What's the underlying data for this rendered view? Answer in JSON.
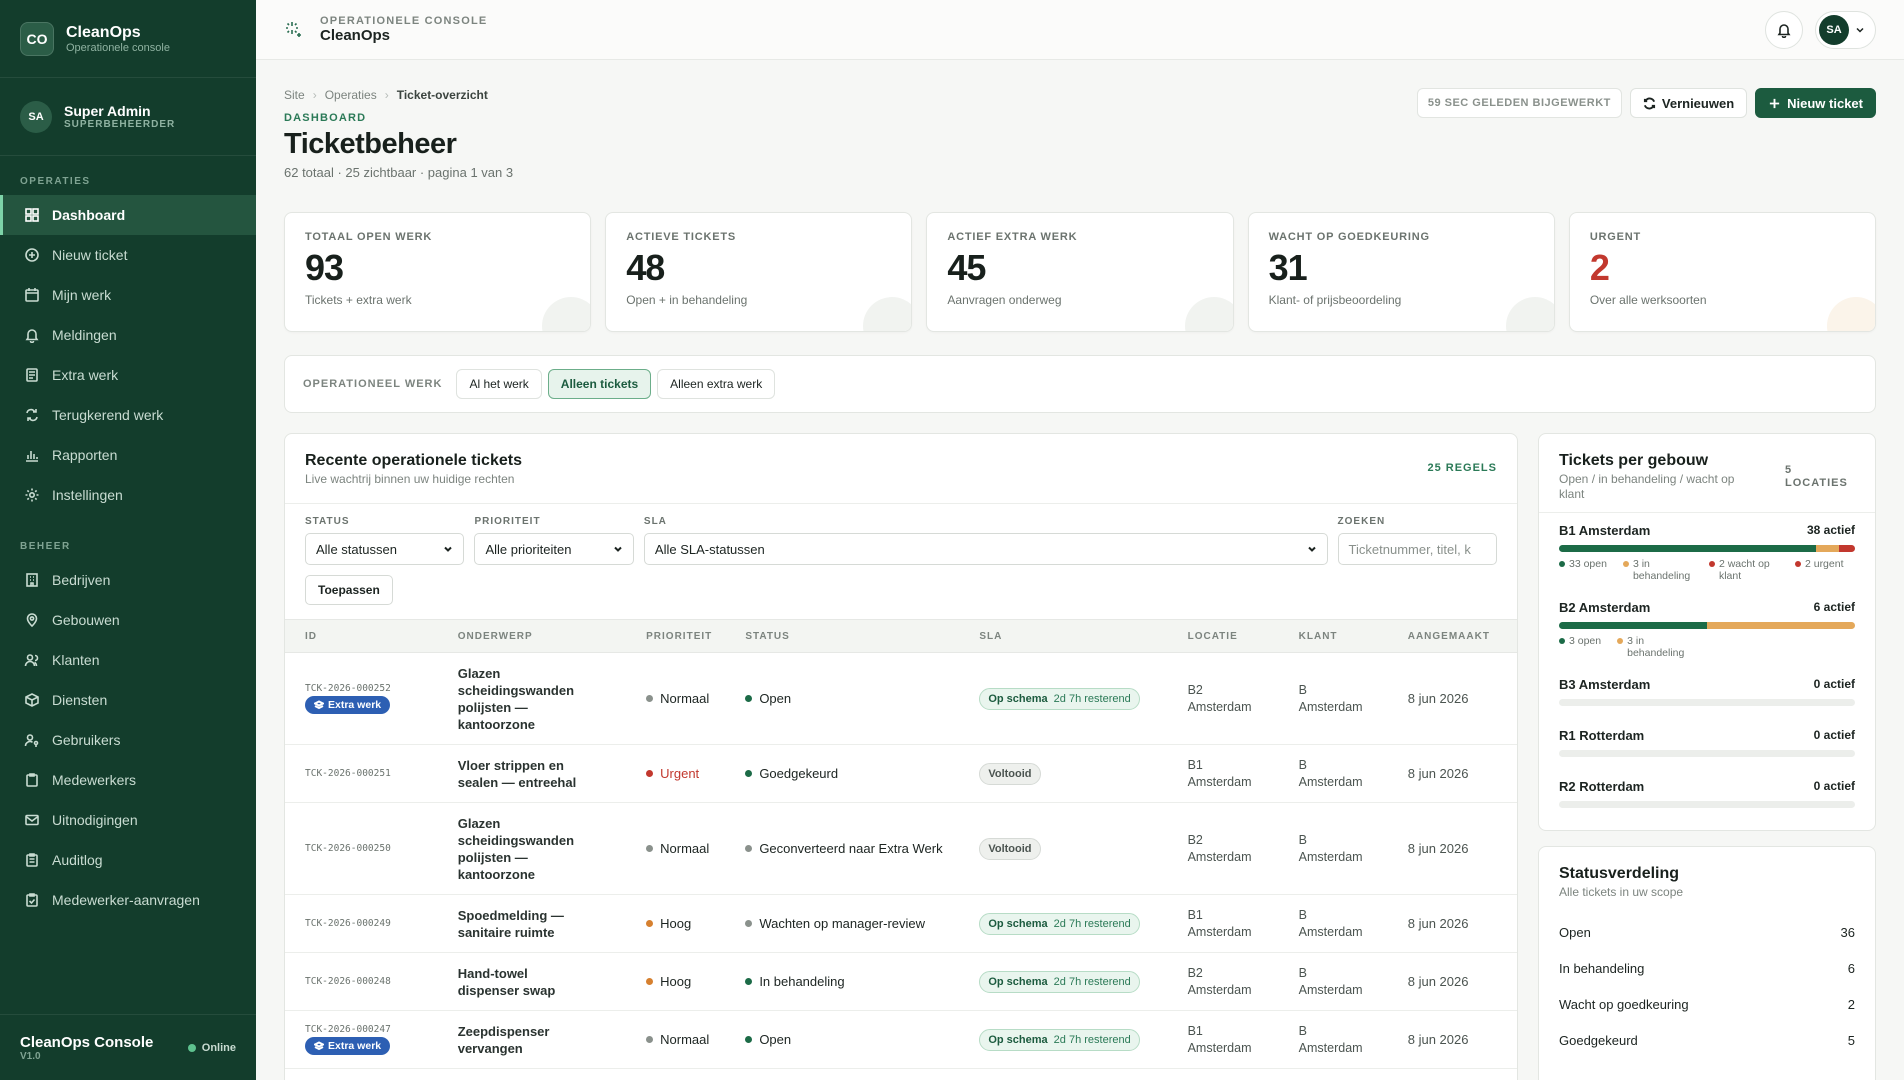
{
  "brand": {
    "logo": "CO",
    "title": "CleanOps",
    "subtitle": "Operationele console"
  },
  "user": {
    "initials": "SA",
    "name": "Super Admin",
    "role": "SUPERBEHEERDER"
  },
  "nav": {
    "section_ops": "OPERATIES",
    "ops": [
      {
        "label": "Dashboard",
        "icon": "grid-icon",
        "active": true
      },
      {
        "label": "Nieuw ticket",
        "icon": "plus-circle-icon"
      },
      {
        "label": "Mijn werk",
        "icon": "calendar-icon"
      },
      {
        "label": "Meldingen",
        "icon": "bell-icon"
      },
      {
        "label": "Extra werk",
        "icon": "document-icon"
      },
      {
        "label": "Terugkerend werk",
        "icon": "repeat-icon"
      },
      {
        "label": "Rapporten",
        "icon": "bar-chart-icon"
      },
      {
        "label": "Instellingen",
        "icon": "gear-icon"
      }
    ],
    "section_beheer": "BEHEER",
    "beheer": [
      {
        "label": "Bedrijven",
        "icon": "building-icon"
      },
      {
        "label": "Gebouwen",
        "icon": "map-pin-icon"
      },
      {
        "label": "Klanten",
        "icon": "users-icon"
      },
      {
        "label": "Diensten",
        "icon": "box-icon"
      },
      {
        "label": "Gebruikers",
        "icon": "user-key-icon"
      },
      {
        "label": "Medewerkers",
        "icon": "clipboard-icon"
      },
      {
        "label": "Uitnodigingen",
        "icon": "mail-icon"
      },
      {
        "label": "Auditlog",
        "icon": "clipboard-list-icon"
      },
      {
        "label": "Medewerker-aanvragen",
        "icon": "clipboard-check-icon"
      }
    ]
  },
  "footer": {
    "title": "CleanOps Console",
    "version": "V1.0",
    "status": "Online"
  },
  "topbar": {
    "kicker": "OPERATIONELE CONSOLE",
    "title": "CleanOps",
    "avatar": "SA"
  },
  "header": {
    "breadcrumb": [
      "Site",
      "Operaties",
      "Ticket-overzicht"
    ],
    "kicker": "DASHBOARD",
    "title": "Ticketbeheer",
    "subtitle": "62 totaal · 25 zichtbaar · pagina 1 van 3",
    "updated": "59 SEC GELEDEN BIJGEWERKT",
    "refresh": "Vernieuwen",
    "new_ticket": "Nieuw ticket"
  },
  "stats": [
    {
      "label": "TOTAAL OPEN WERK",
      "value": "93",
      "desc": "Tickets + extra werk"
    },
    {
      "label": "ACTIEVE TICKETS",
      "value": "48",
      "desc": "Open + in behandeling"
    },
    {
      "label": "ACTIEF EXTRA WERK",
      "value": "45",
      "desc": "Aanvragen onderweg"
    },
    {
      "label": "WACHT OP GOEDKEURING",
      "value": "31",
      "desc": "Klant- of prijsbeoordeling"
    },
    {
      "label": "URGENT",
      "value": "2",
      "desc": "Over alle werksoorten"
    }
  ],
  "work_filter": {
    "label": "OPERATIONEEL WERK",
    "options": [
      "Al het werk",
      "Alleen tickets",
      "Alleen extra werk"
    ],
    "active": "Alleen tickets"
  },
  "table": {
    "title": "Recente operationele tickets",
    "subtitle": "Live wachtrij binnen uw huidige rechten",
    "count": "25 REGELS",
    "filters": {
      "status_label": "STATUS",
      "status_value": "Alle statussen",
      "priority_label": "PRIORITEIT",
      "priority_value": "Alle prioriteiten",
      "sla_label": "SLA",
      "sla_value": "Alle SLA-statussen",
      "search_label": "ZOEKEN",
      "search_placeholder": "Ticketnummer, titel, k",
      "apply": "Toepassen"
    },
    "columns": [
      "ID",
      "ONDERWERP",
      "PRIORITEIT",
      "STATUS",
      "SLA",
      "LOCATIE",
      "KLANT",
      "AANGEMAAKT"
    ],
    "rows": [
      {
        "id": "TCK-2026-000252",
        "extra": "Extra werk",
        "subject": "Glazen scheidingswanden polijsten — kantoorzone",
        "priority": "Normaal",
        "status": "Open",
        "sla": "Op schema",
        "sla_rest": "2d 7h resterend",
        "location": "B2 Amsterdam",
        "client": "B Amsterdam",
        "created": "8 jun 2026"
      },
      {
        "id": "TCK-2026-000251",
        "extra": "",
        "subject": "Vloer strippen en sealen — entreehal",
        "priority": "Urgent",
        "status": "Goedgekeurd",
        "sla": "Voltooid",
        "sla_rest": "",
        "location": "B1 Amsterdam",
        "client": "B Amsterdam",
        "created": "8 jun 2026"
      },
      {
        "id": "TCK-2026-000250",
        "extra": "",
        "subject": "Glazen scheidingswanden polijsten — kantoorzone",
        "priority": "Normaal",
        "status": "Geconverteerd naar Extra Werk",
        "sla": "Voltooid",
        "sla_rest": "",
        "location": "B2 Amsterdam",
        "client": "B Amsterdam",
        "created": "8 jun 2026"
      },
      {
        "id": "TCK-2026-000249",
        "extra": "",
        "subject": "Spoedmelding — sanitaire ruimte",
        "priority": "Hoog",
        "status": "Wachten op manager-review",
        "sla": "Op schema",
        "sla_rest": "2d 7h resterend",
        "location": "B1 Amsterdam",
        "client": "B Amsterdam",
        "created": "8 jun 2026"
      },
      {
        "id": "TCK-2026-000248",
        "extra": "",
        "subject": "Hand-towel dispenser swap",
        "priority": "Hoog",
        "status": "In behandeling",
        "sla": "Op schema",
        "sla_rest": "2d 7h resterend",
        "location": "B2 Amsterdam",
        "client": "B Amsterdam",
        "created": "8 jun 2026"
      },
      {
        "id": "TCK-2026-000247",
        "extra": "Extra werk",
        "subject": "Zeepdispenser vervangen",
        "priority": "Normaal",
        "status": "Open",
        "sla": "Op schema",
        "sla_rest": "2d 7h resterend",
        "location": "B1 Amsterdam",
        "client": "B Amsterdam",
        "created": "8 jun 2026"
      }
    ]
  },
  "buildings": {
    "title": "Tickets per gebouw",
    "subtitle": "Open / in behandeling / wacht op klant",
    "count": "5 LOCATIES",
    "items": [
      {
        "name": "B1 Amsterdam",
        "active": "38 actief",
        "open": 33,
        "behandeling": 3,
        "wacht": 2,
        "total": 38,
        "legend": [
          {
            "text": "33 open",
            "color": "#1c6b47"
          },
          {
            "text": "3 in behandeling",
            "color": "#e4a85a"
          },
          {
            "text": "2 wacht op klant",
            "color": "#c2382e"
          },
          {
            "text": "2 urgent",
            "color": "#c2382e"
          }
        ]
      },
      {
        "name": "B2 Amsterdam",
        "active": "6 actief",
        "open": 3,
        "behandeling": 3,
        "wacht": 0,
        "total": 6,
        "legend": [
          {
            "text": "3 open",
            "color": "#1c6b47"
          },
          {
            "text": "3 in behandeling",
            "color": "#e4a85a"
          }
        ]
      },
      {
        "name": "B3 Amsterdam",
        "active": "0 actief",
        "open": 0,
        "behandeling": 0,
        "wacht": 0,
        "total": 0,
        "legend": []
      },
      {
        "name": "R1 Rotterdam",
        "active": "0 actief",
        "open": 0,
        "behandeling": 0,
        "wacht": 0,
        "total": 0,
        "legend": []
      },
      {
        "name": "R2 Rotterdam",
        "active": "0 actief",
        "open": 0,
        "behandeling": 0,
        "wacht": 0,
        "total": 0,
        "legend": []
      }
    ]
  },
  "status_dist": {
    "title": "Statusverdeling",
    "subtitle": "Alle tickets in uw scope",
    "items": [
      {
        "label": "Open",
        "value": "36"
      },
      {
        "label": "In behandeling",
        "value": "6"
      },
      {
        "label": "Wacht op goedkeuring",
        "value": "2"
      },
      {
        "label": "Goedgekeurd",
        "value": "5"
      }
    ]
  },
  "colors": {
    "sidebar": "#133d2c",
    "accent": "#1c5b3f",
    "urgent": "#c2382e",
    "extra_badge": "#2d5fb3"
  }
}
